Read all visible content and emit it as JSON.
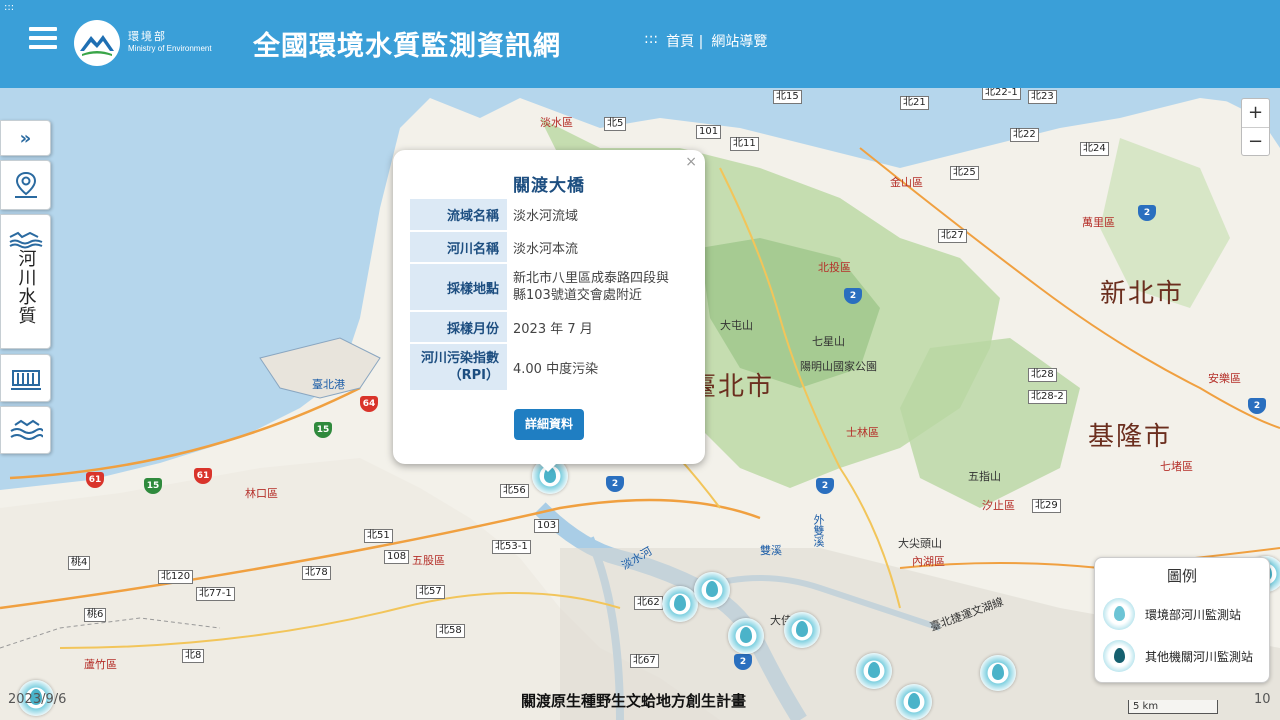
{
  "header": {
    "corner_mark": ":::",
    "logo_cn": "環境部",
    "logo_en": "Ministry of Environment",
    "title": "全國環境水質監測資訊網",
    "nav_marker": ":::",
    "nav_home": "首頁 |",
    "nav_sitemap": "網站導覽"
  },
  "toolbar": {
    "river_quality_label": "河川水質"
  },
  "zoom": {
    "in": "+",
    "out": "−"
  },
  "map": {
    "cities": [
      "新北市",
      "臺北市",
      "基隆市"
    ],
    "districts": [
      "淡水區",
      "金山區",
      "萬里區",
      "北投區",
      "士林區",
      "汐止區",
      "七堵區",
      "安樂區",
      "五股區",
      "林口區",
      "蘆竹區",
      "內湖區",
      "大屯山",
      "七星山",
      "五指山",
      "大尖頭山",
      "陽明山國家公園",
      "臺北港",
      "淡水河",
      "外雙溪",
      "雙溪",
      "大佳",
      "臺北捷運文湖線"
    ],
    "roads": [
      "北15",
      "北21",
      "北22",
      "北22-1",
      "北23",
      "北24",
      "北25",
      "北27",
      "北11",
      "北5",
      "101",
      "北56",
      "103",
      "北53-1",
      "北51",
      "108",
      "北78",
      "北120",
      "北77-1",
      "北57",
      "北58",
      "北62",
      "北67",
      "北28",
      "北28-2",
      "北29",
      "北8",
      "桃4",
      "桃6"
    ]
  },
  "popup": {
    "close": "×",
    "title": "關渡大橋",
    "rows": [
      {
        "key": "流域名稱",
        "value": "淡水河流域"
      },
      {
        "key": "河川名稱",
        "value": "淡水河本流"
      },
      {
        "key": "採樣地點",
        "value": "新北市八里區成泰路四段與縣103號道交會處附近"
      },
      {
        "key": "採樣月份",
        "value": "2023 年 7 月"
      },
      {
        "key": "河川污染指數（RPI）",
        "value": "4.00 中度污染"
      }
    ],
    "button": "詳細資料"
  },
  "legend": {
    "title": "圖例",
    "items": [
      {
        "label": "環境部河川監測站",
        "icon": "light-drop-icon"
      },
      {
        "label": "其他機關河川監測站",
        "icon": "dark-drop-icon"
      }
    ]
  },
  "footer": {
    "date": "2023/9/6",
    "caption": "關渡原生種野生文蛤地方創生計畫",
    "page": "10",
    "scale": "5 km"
  },
  "colors": {
    "header": "#3a9fd8",
    "button": "#1f7ec2",
    "table_key_bg": "#dce9f5",
    "title": "#1d4e80"
  }
}
